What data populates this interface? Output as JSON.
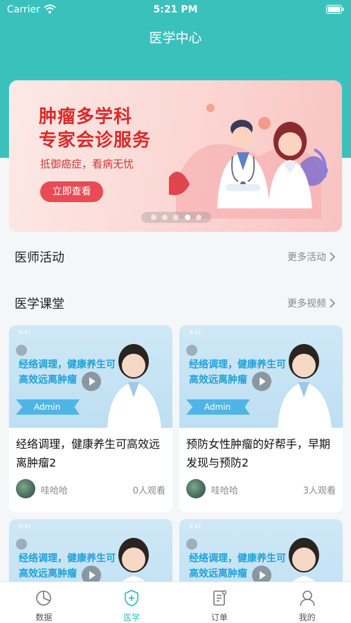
{
  "status_bar": {
    "carrier": "Carrier",
    "time": "5:21 PM"
  },
  "nav": {
    "title": "医学中心"
  },
  "banner": {
    "title_line1": "肿瘤多学科",
    "title_line2": "专家会诊服务",
    "subtitle": "抵御癌症，看病无忧",
    "button": "立即查看",
    "pages": 5,
    "active_page": 4
  },
  "sections": {
    "activities": {
      "title": "医师活动",
      "more": "更多活动"
    },
    "classroom": {
      "title": "医学课堂",
      "more": "更多视频"
    }
  },
  "thumbnail": {
    "status_time": "9:41",
    "text": "经络调理，健康养生可高效远离肿瘤",
    "badge": "Admin"
  },
  "videos": [
    {
      "title": "经络调理，健康养生可高效远离肿瘤2",
      "author": "哇哈哈",
      "views": "0人观看"
    },
    {
      "title": "预防女性肿瘤的好帮手，早期发现与预防2",
      "author": "哇哈哈",
      "views": "3人观看"
    }
  ],
  "tabs": [
    {
      "label": "数据",
      "icon": "pie-chart-icon"
    },
    {
      "label": "医学",
      "icon": "shield-cross-icon",
      "active": true
    },
    {
      "label": "订单",
      "icon": "order-list-icon"
    },
    {
      "label": "我的",
      "icon": "person-icon"
    }
  ],
  "colors": {
    "accent": "#3bc1bc",
    "banner_red": "#d92b2b",
    "thumb_blue": "#1fa1d8"
  }
}
